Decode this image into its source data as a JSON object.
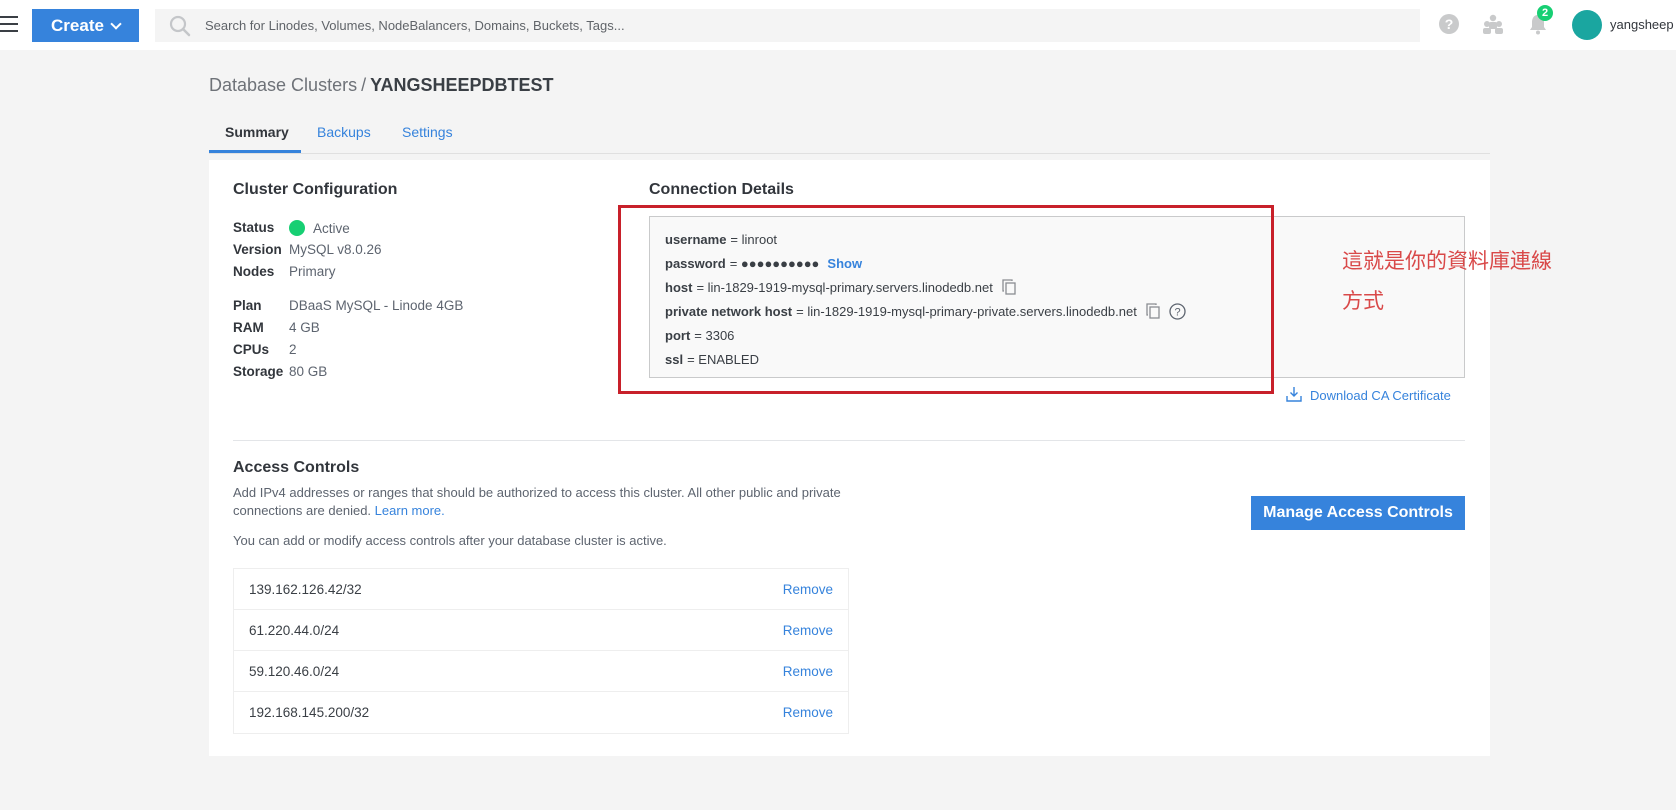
{
  "topbar": {
    "create_label": "Create",
    "search_placeholder": "Search for Linodes, Volumes, NodeBalancers, Domains, Buckets, Tags...",
    "notification_count": "2",
    "username": "yangsheep"
  },
  "breadcrumb": {
    "parent": "Database Clusters",
    "separator": "/",
    "current": "YANGSHEEPDBTEST"
  },
  "tabs": [
    "Summary",
    "Backups",
    "Settings"
  ],
  "cluster_config": {
    "title": "Cluster Configuration",
    "status_label": "Status",
    "status_value": "Active",
    "version_label": "Version",
    "version_value": "MySQL v8.0.26",
    "nodes_label": "Nodes",
    "nodes_value": "Primary",
    "plan_label": "Plan",
    "plan_value": "DBaaS MySQL - Linode 4GB",
    "ram_label": "RAM",
    "ram_value": "4 GB",
    "cpus_label": "CPUs",
    "cpus_value": "2",
    "storage_label": "Storage",
    "storage_value": "80 GB"
  },
  "connection": {
    "title": "Connection Details",
    "username_key": "username",
    "username_value": "= linroot",
    "password_key": "password",
    "password_value": "= ●●●●●●●●●●",
    "show_label": "Show",
    "host_key": "host",
    "host_value": "= lin-1829-1919-mysql-primary.servers.linodedb.net",
    "private_host_key": "private network host",
    "private_host_value": "= lin-1829-1919-mysql-primary-private.servers.linodedb.net",
    "port_key": "port",
    "port_value": "= 3306",
    "ssl_key": "ssl",
    "ssl_value": "= ENABLED",
    "download_label": "Download CA Certificate"
  },
  "annotation": {
    "line1": "這就是你的資料庫連線",
    "line2": "方式",
    "color": "#d94949"
  },
  "access_controls": {
    "title": "Access Controls",
    "description": "Add IPv4 addresses or ranges that should be authorized to access this cluster. All other public and private connections are denied.",
    "learn_more": "Learn more.",
    "note": "You can add or modify access controls after your database cluster is active.",
    "manage_label": "Manage Access Controls",
    "remove_label": "Remove",
    "ips": [
      "139.162.126.42/32",
      "61.220.44.0/24",
      "59.120.46.0/24",
      "192.168.145.200/32"
    ]
  },
  "colors": {
    "accent": "#3683dc",
    "status_active": "#17cf73",
    "highlight": "#c8202a"
  }
}
